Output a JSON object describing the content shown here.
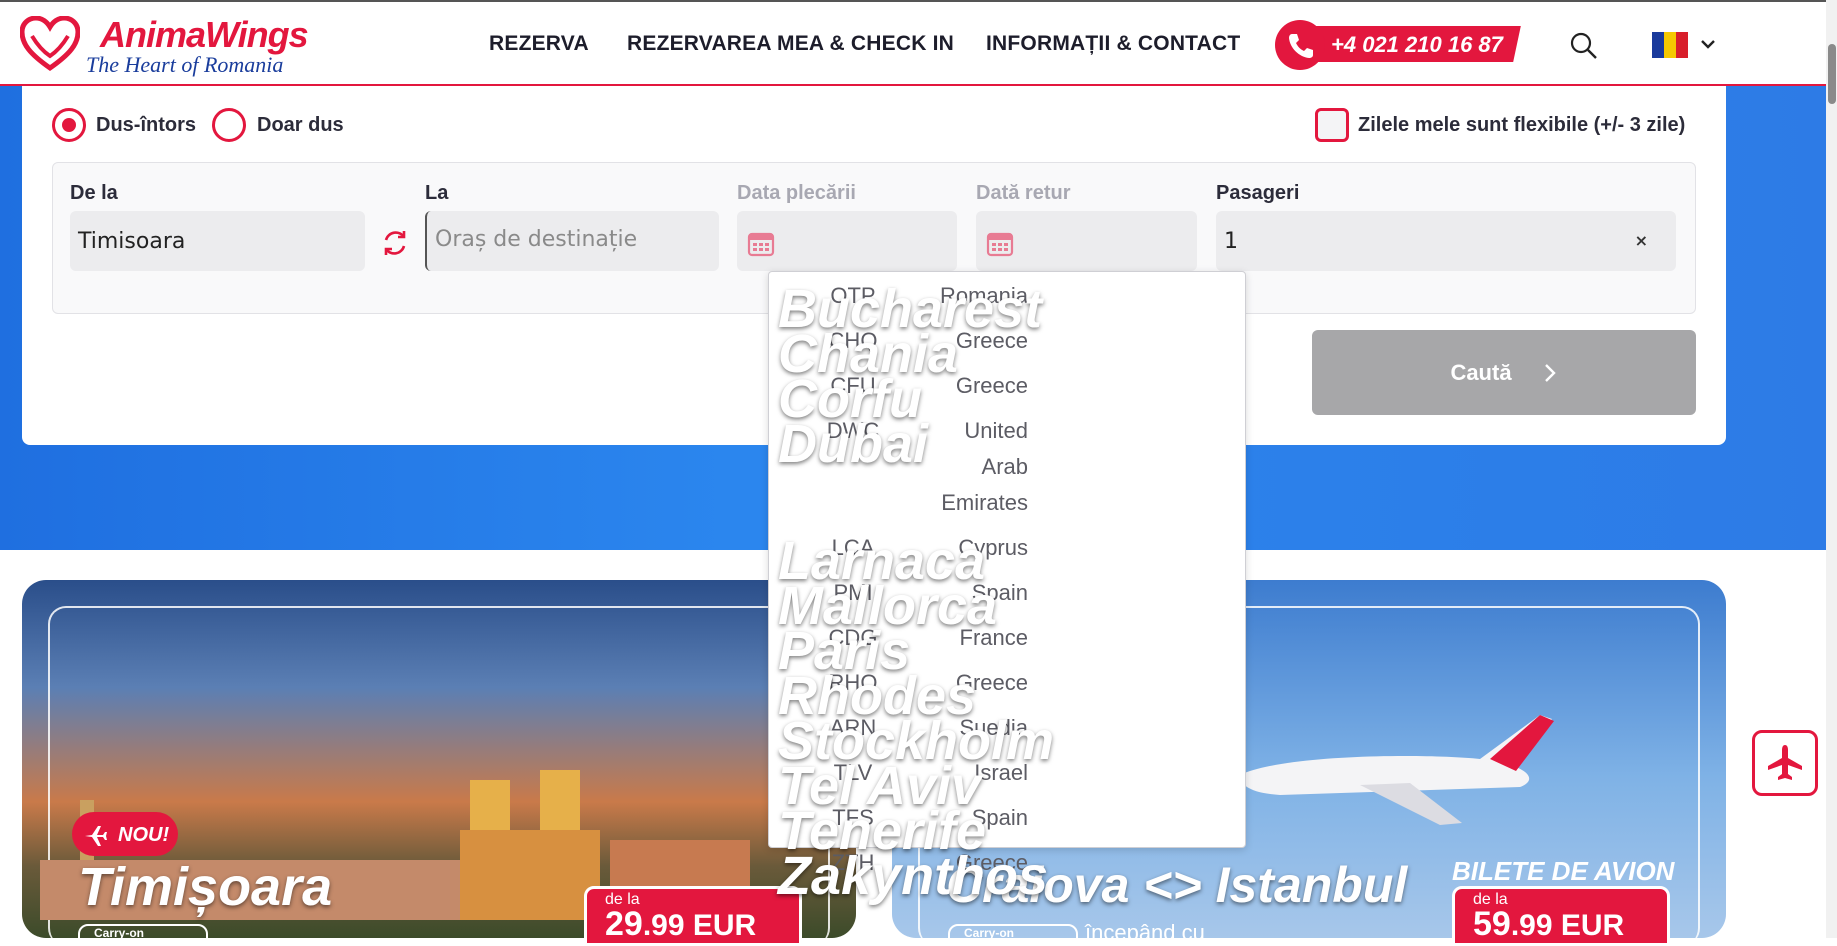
{
  "header": {
    "brand": "AnimaWings",
    "tagline": "The Heart of Romania",
    "nav": [
      "REZERVA",
      "REZERVAREA MEA & CHECK IN",
      "INFORMAȚII & CONTACT"
    ],
    "phone": "+4 021 210 16 87",
    "language_flag": "romania-flag"
  },
  "search": {
    "trip_types": [
      {
        "label": "Dus-întors",
        "selected": true
      },
      {
        "label": "Doar dus",
        "selected": false
      }
    ],
    "flexible_label": "Zilele mele sunt flexibile (+/- 3 zile)",
    "flexible_checked": false,
    "from_label": "De la",
    "from_value": "Timisoara",
    "to_label": "La",
    "to_placeholder": "Oraș de destinație",
    "depart_label": "Data plecării",
    "return_label": "Dată retur",
    "passengers_label": "Pasageri",
    "passengers_value": "1",
    "clear_symbol": "×",
    "search_button": "Caută"
  },
  "destinations": [
    {
      "city": "Bucharest",
      "code": "OTP",
      "country": "Romania"
    },
    {
      "city": "Chania",
      "code": "CHQ",
      "country": "Greece"
    },
    {
      "city": "Corfu",
      "code": "CFU",
      "country": "Greece"
    },
    {
      "city": "Dubai",
      "code": "DWC",
      "country": "United Arab Emirates"
    },
    {
      "city": "Larnaca",
      "code": "LCA",
      "country": "Cyprus"
    },
    {
      "city": "Mallorca",
      "code": "PMI",
      "country": "Spain"
    },
    {
      "city": "Paris",
      "code": "CDG",
      "country": "France"
    },
    {
      "city": "Rhodes",
      "code": "RHO",
      "country": "Greece"
    },
    {
      "city": "Stockholm",
      "code": "ARN",
      "country": "Suedia"
    },
    {
      "city": "Tel Aviv",
      "code": "TLV",
      "country": "Israel"
    },
    {
      "city": "Tenerife",
      "code": "TFS",
      "country": "Spain"
    },
    {
      "city": "Zakynthos",
      "code": "ZTH",
      "country": "Greece"
    }
  ],
  "promos": {
    "card1": {
      "badge": "NOU!",
      "city": "Timișoara",
      "price_prefix": "de la",
      "price_main": "29",
      "price_rest": ".99 EUR",
      "carry": "Carry-on"
    },
    "card2": {
      "city": "Craiova <> Istanbul",
      "tag": "BILETE DE AVION",
      "price_prefix": "de la",
      "price_main": "59",
      "price_rest": ".99 EUR",
      "carry": "Carry-on",
      "starting": "începând cu"
    }
  },
  "colors": {
    "accent": "#e3173e",
    "hero_blue": "#2b86ee",
    "button_disabled": "#a7a7a9"
  }
}
